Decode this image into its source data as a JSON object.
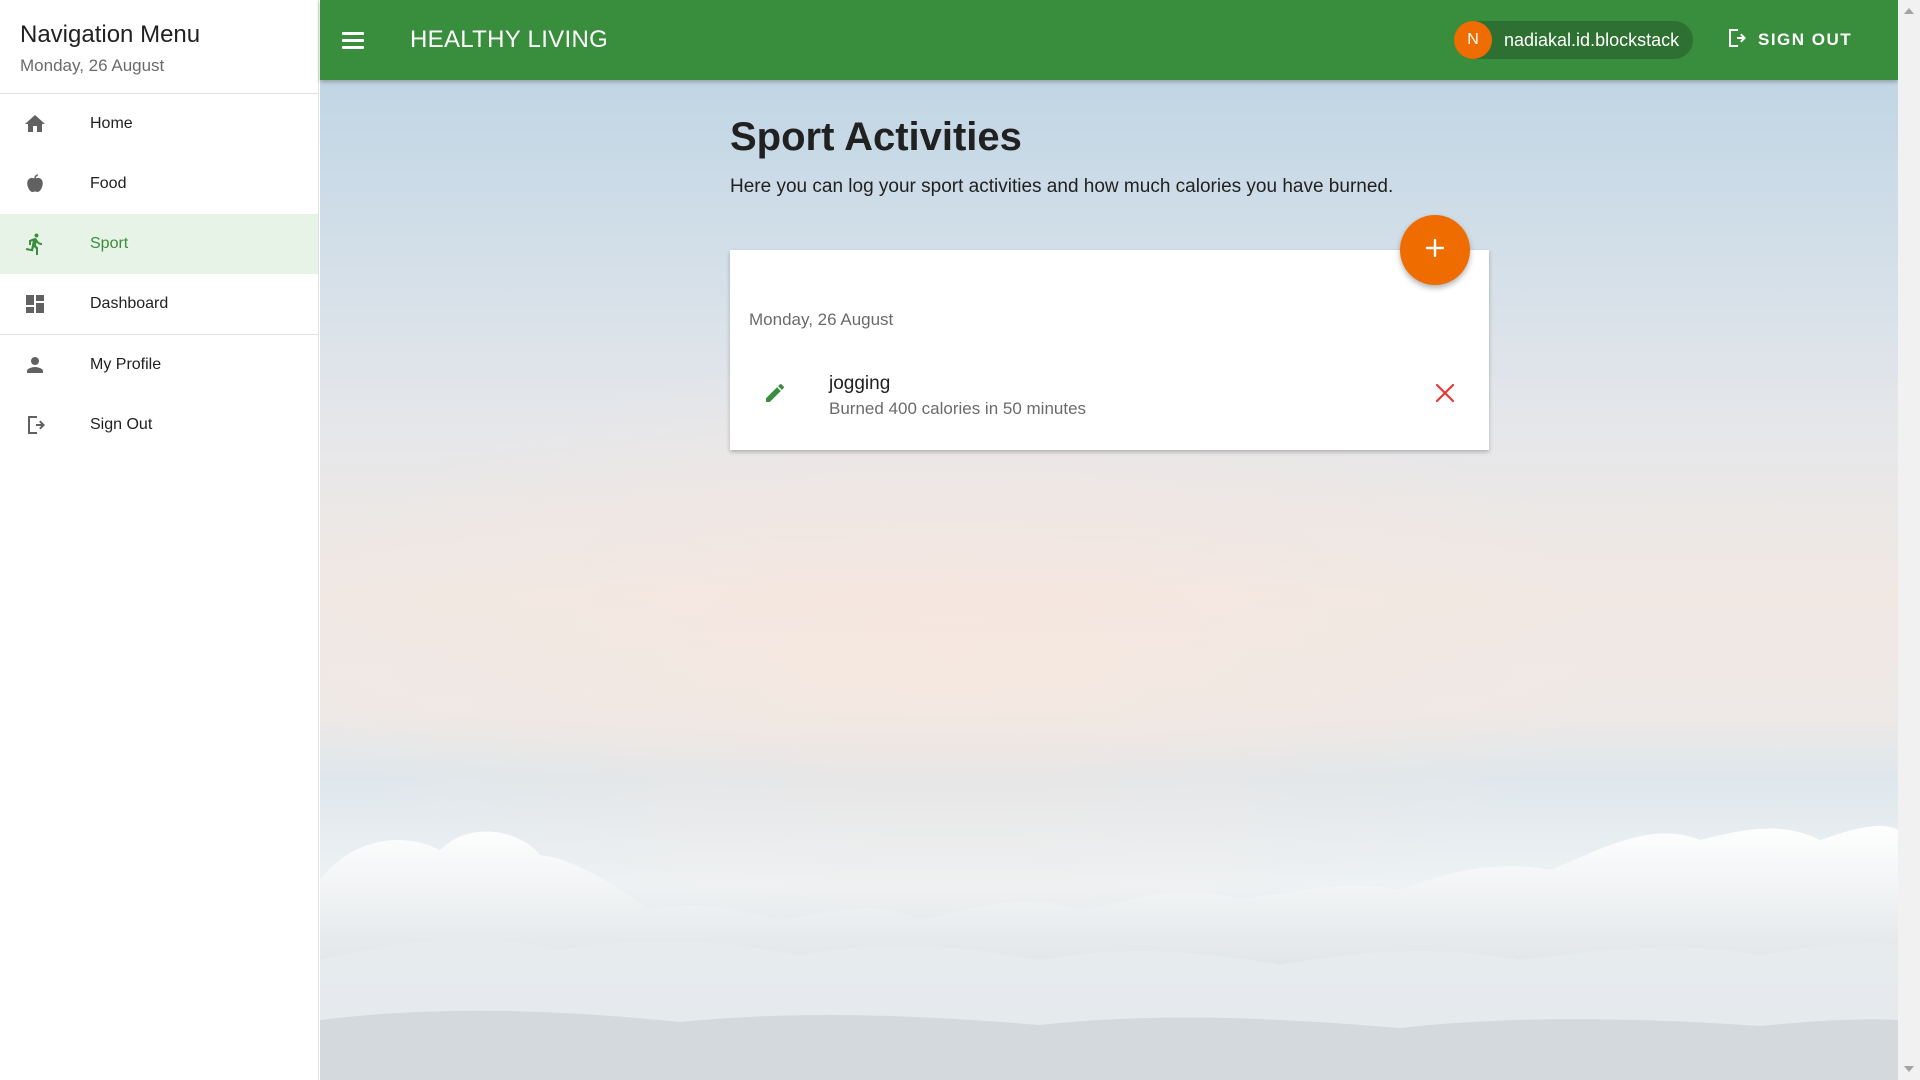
{
  "sidebar": {
    "title": "Navigation Menu",
    "date": "Monday, 26 August",
    "items": [
      {
        "label": "Home",
        "icon": "home-icon"
      },
      {
        "label": "Food",
        "icon": "apple-icon"
      },
      {
        "label": "Sport",
        "icon": "run-icon",
        "active": true
      },
      {
        "label": "Dashboard",
        "icon": "dashboard-icon"
      },
      {
        "label": "My Profile",
        "icon": "person-icon"
      },
      {
        "label": "Sign Out",
        "icon": "exit-icon"
      }
    ]
  },
  "topbar": {
    "title": "HEALTHY LIVING",
    "user_initial": "N",
    "user_name": "nadiakal.id.blockstack",
    "signout_label": "SIGN OUT"
  },
  "page": {
    "title": "Sport Activities",
    "description": "Here you can log your sport activities and how much calories you have burned."
  },
  "card": {
    "date": "Monday, 26 August",
    "activities": [
      {
        "name": "jogging",
        "detail": "Burned 400 calories in 50 minutes"
      }
    ]
  },
  "colors": {
    "primary": "#388e3c",
    "accent": "#ef6c00",
    "delete": "#e53935"
  }
}
